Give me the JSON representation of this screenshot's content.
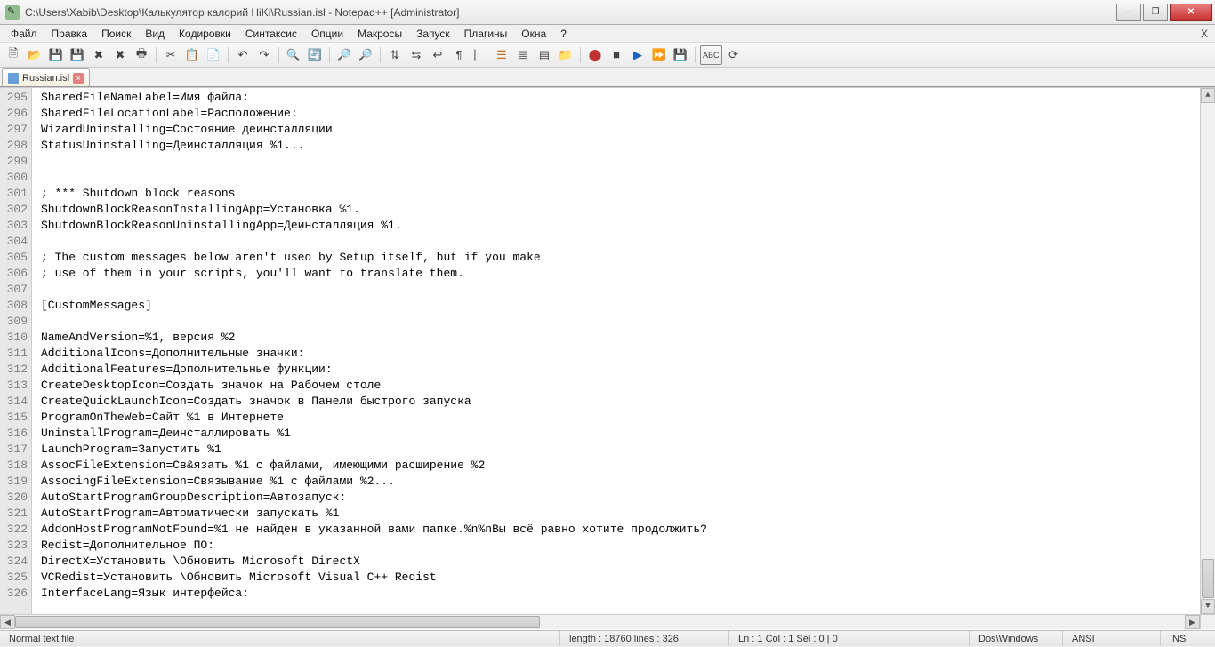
{
  "window": {
    "title": "C:\\Users\\Xabib\\Desktop\\Калькулятор калорий HiKi\\Russian.isl - Notepad++ [Administrator]"
  },
  "menu": {
    "items": [
      "Файл",
      "Правка",
      "Поиск",
      "Вид",
      "Кодировки",
      "Синтаксис",
      "Опции",
      "Макросы",
      "Запуск",
      "Плагины",
      "Окна",
      "?"
    ],
    "close_x": "X"
  },
  "tab": {
    "label": "Russian.isl"
  },
  "gutter_start": 295,
  "lines": [
    "SharedFileNameLabel=Имя файла:",
    "SharedFileLocationLabel=Расположение:",
    "WizardUninstalling=Состояние деинсталляции",
    "StatusUninstalling=Деинсталляция %1...",
    "",
    "",
    "; *** Shutdown block reasons",
    "ShutdownBlockReasonInstallingApp=Установка %1.",
    "ShutdownBlockReasonUninstallingApp=Деинсталляция %1.",
    "",
    "; The custom messages below aren't used by Setup itself, but if you make",
    "; use of them in your scripts, you'll want to translate them.",
    "",
    "[CustomMessages]",
    "",
    "NameAndVersion=%1, версия %2",
    "AdditionalIcons=Дополнительные значки:",
    "AdditionalFeatures=Дополнительные функции:",
    "CreateDesktopIcon=Создать значок на Рабочем столе",
    "CreateQuickLaunchIcon=Создать значок в Панели быстрого запуска",
    "ProgramOnTheWeb=Сайт %1 в Интернете",
    "UninstallProgram=Деинсталлировать %1",
    "LaunchProgram=Запустить %1",
    "AssocFileExtension=Св&язать %1 с файлами, имеющими расширение %2",
    "AssocingFileExtension=Связывание %1 с файлами %2...",
    "AutoStartProgramGroupDescription=Автозапуск:",
    "AutoStartProgram=Автоматически запускать %1",
    "AddonHostProgramNotFound=%1 не найден в указанной вами папке.%n%nВы всё равно хотите продолжить?",
    "Redist=Дополнительное ПО:",
    "DirectX=Установить \\Обновить Microsoft DirectX",
    "VCRedist=Установить \\Обновить Microsoft Visual C++ Redist",
    "InterfaceLang=Язык интерфейса:"
  ],
  "status": {
    "filetype": "Normal text file",
    "length": "length : 18760    lines : 326",
    "pos": "Ln : 1    Col : 1    Sel : 0 | 0",
    "eol": "Dos\\Windows",
    "encoding": "ANSI",
    "mode": "INS"
  }
}
